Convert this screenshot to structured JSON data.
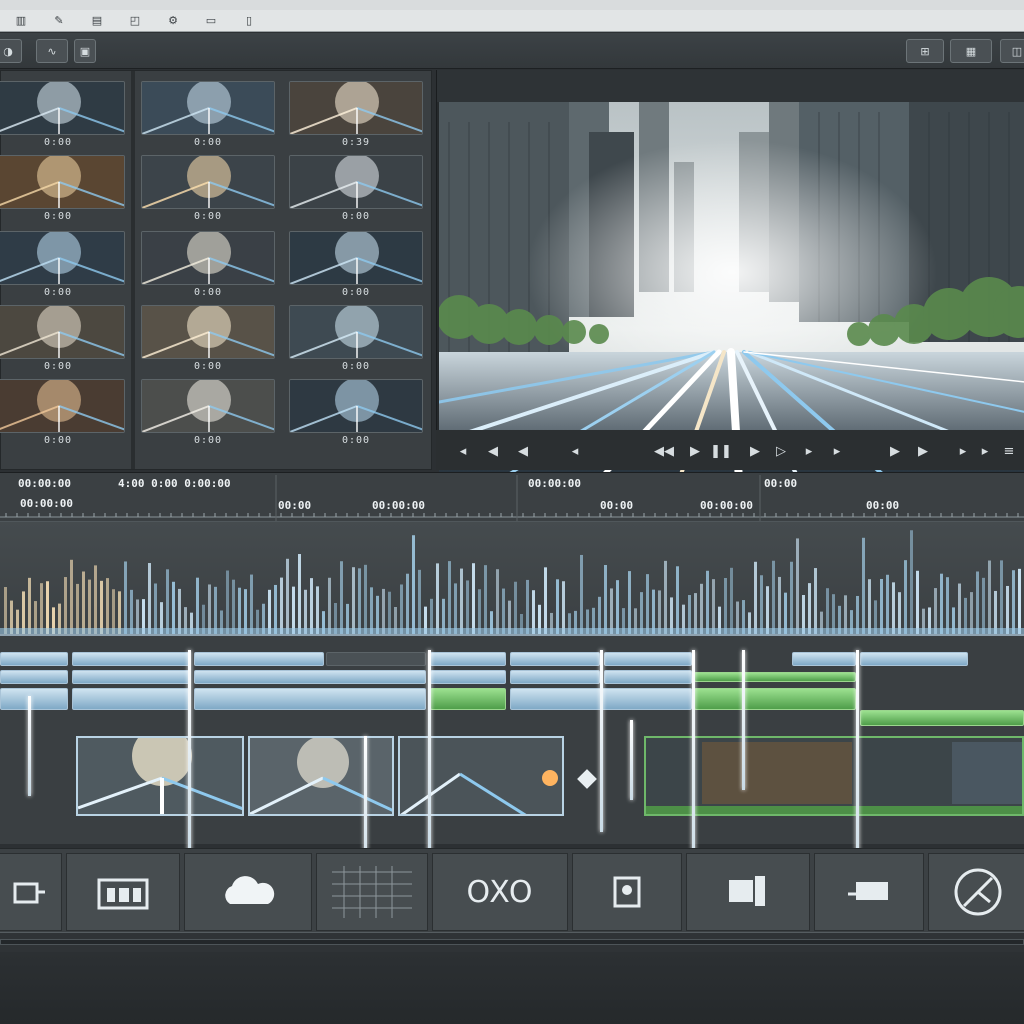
{
  "toolbar": {
    "icons": [
      "film-icon",
      "scissors-icon",
      "book-icon",
      "clip-icon",
      "gear-icon",
      "monitor-icon",
      "panel-icon"
    ],
    "left_buttons": [
      "back-icon",
      "link-icon",
      "lock-icon"
    ],
    "right_buttons": [
      "grid-icon",
      "layout-icon",
      "export-icon"
    ]
  },
  "browser": {
    "thumbnails": [
      {
        "label": "0:00"
      },
      {
        "label": "0:00"
      },
      {
        "label": "0:39"
      },
      {
        "label": "0:00"
      },
      {
        "label": "0:00"
      },
      {
        "label": "0:00"
      },
      {
        "label": "0:00"
      },
      {
        "label": "0:00"
      },
      {
        "label": "0:00"
      },
      {
        "label": "0:00"
      },
      {
        "label": "0:00"
      },
      {
        "label": "0:00"
      },
      {
        "label": "0:00"
      },
      {
        "label": "0:00"
      },
      {
        "label": "0:00"
      }
    ]
  },
  "viewer": {
    "title": ""
  },
  "transport": {
    "buttons": [
      "◂",
      "◀",
      "◀",
      "◂",
      "◀◀",
      "▶",
      "❚❚",
      "▶",
      "▷",
      "▸",
      "▸",
      "▶",
      "▶",
      "▸",
      "▸",
      "≡"
    ]
  },
  "timeline": {
    "timecodes": [
      "00:00",
      "0:00 0:00",
      "0:00 00:00",
      "00:00",
      "00:00",
      "00:00",
      "00:00",
      "00:00",
      "00:00",
      "00:00",
      "00:00"
    ],
    "ruler_tc": [
      {
        "text": "00:00:00"
      },
      {
        "text": "4:00 0:00  0:00:00"
      },
      {
        "text": "00:00:00"
      },
      {
        "text": "00:00"
      },
      {
        "text": "00:00:00"
      },
      {
        "text": "00:00:00"
      },
      {
        "text": "00:00"
      },
      {
        "text": "00:00:00"
      },
      {
        "text": "00:00"
      },
      {
        "text": "00:00"
      }
    ]
  },
  "tools": {
    "buttons": [
      {
        "name": "capture-tool-button",
        "icon": "camera-icon"
      },
      {
        "name": "titles-tool-button",
        "icon": "titles-icon"
      },
      {
        "name": "cloud-tool-button",
        "icon": "cloud-icon"
      },
      {
        "name": "grid-tool-button",
        "icon": "grid-icon"
      },
      {
        "name": "oxo-tool-button",
        "icon": "oxo-icon",
        "label": "OXO"
      },
      {
        "name": "photo-tool-button",
        "icon": "photo-icon"
      },
      {
        "name": "clip-tool-button",
        "icon": "clip-icon"
      },
      {
        "name": "transition-tool-button",
        "icon": "transition-icon"
      },
      {
        "name": "export-tool-button",
        "icon": "no-entry-icon"
      }
    ]
  },
  "colors": {
    "accent_blue": "#8ec9ee",
    "track_green": "#5fbf58",
    "panel_bg": "#3a3f42"
  }
}
